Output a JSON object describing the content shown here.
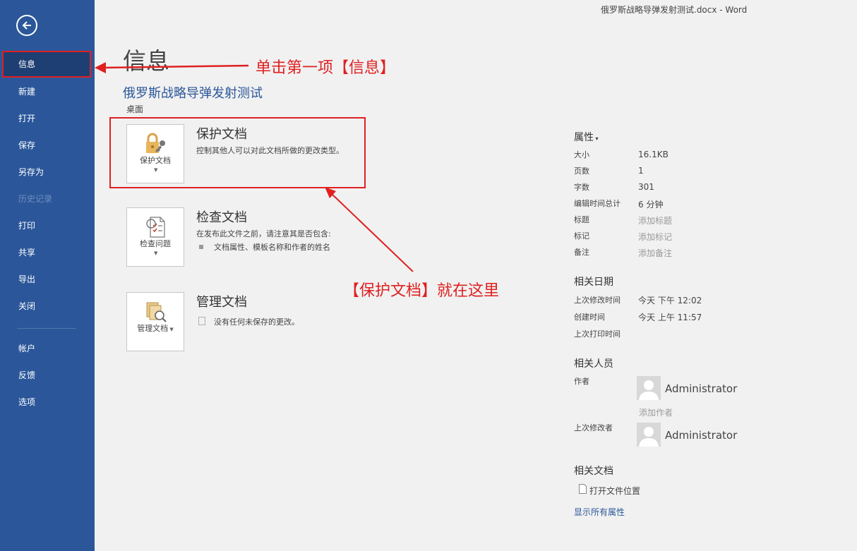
{
  "window": {
    "title": "俄罗斯战略导弹发射测试.docx  -  Word"
  },
  "sidebar": {
    "back_icon": "back-arrow-icon",
    "items": [
      {
        "label": "信息",
        "active": true
      },
      {
        "label": "新建"
      },
      {
        "label": "打开"
      },
      {
        "label": "保存"
      },
      {
        "label": "另存为"
      },
      {
        "label": "历史记录",
        "disabled": true
      },
      {
        "label": "打印"
      },
      {
        "label": "共享"
      },
      {
        "label": "导出"
      },
      {
        "label": "关闭"
      },
      {
        "label": "帐户"
      },
      {
        "label": "反馈"
      },
      {
        "label": "选项"
      }
    ]
  },
  "main": {
    "title": "信息",
    "doc_name": "俄罗斯战略导弹发射测试",
    "doc_location": "桌面",
    "sections": [
      {
        "button_label": "保护文档",
        "icon": "lock-key-icon",
        "title": "保护文档",
        "desc": "控制其他人可以对此文档所做的更改类型。"
      },
      {
        "button_label": "检查问题",
        "icon": "inspect-document-icon",
        "title": "检查文档",
        "desc": "在发布此文件之前，请注意其是否包含:",
        "bullet": "文档属性、模板名称和作者的姓名"
      },
      {
        "button_label": "管理文档",
        "icon": "manage-document-icon",
        "title": "管理文档",
        "desc": "没有任何未保存的更改。"
      }
    ]
  },
  "properties": {
    "header": "属性",
    "rows": [
      {
        "label": "大小",
        "value": "16.1KB"
      },
      {
        "label": "页数",
        "value": "1"
      },
      {
        "label": "字数",
        "value": "301"
      },
      {
        "label": "编辑时间总计",
        "value": "6 分钟"
      },
      {
        "label": "标题",
        "value": "添加标题"
      },
      {
        "label": "标记",
        "value": "添加标记"
      },
      {
        "label": "备注",
        "value": "添加备注"
      }
    ],
    "dates_header": "相关日期",
    "dates": [
      {
        "label": "上次修改时间",
        "value": "今天 下午 12:02"
      },
      {
        "label": "创建时间",
        "value": "今天 上午 11:57"
      },
      {
        "label": "上次打印时间",
        "value": ""
      }
    ],
    "people_header": "相关人员",
    "author_label": "作者",
    "author_name": "Administrator",
    "add_author": "添加作者",
    "modifier_label": "上次修改者",
    "modifier_name": "Administrator",
    "docs_header": "相关文档",
    "open_location": "打开文件位置",
    "show_all": "显示所有属性"
  },
  "annotations": {
    "arrow1_text": "单击第一项【信息】",
    "arrow2_text": "【保护文档】就在这里"
  },
  "colors": {
    "sidebar": "#2b579a",
    "annotation": "#e02020",
    "link": "#2b579a"
  }
}
